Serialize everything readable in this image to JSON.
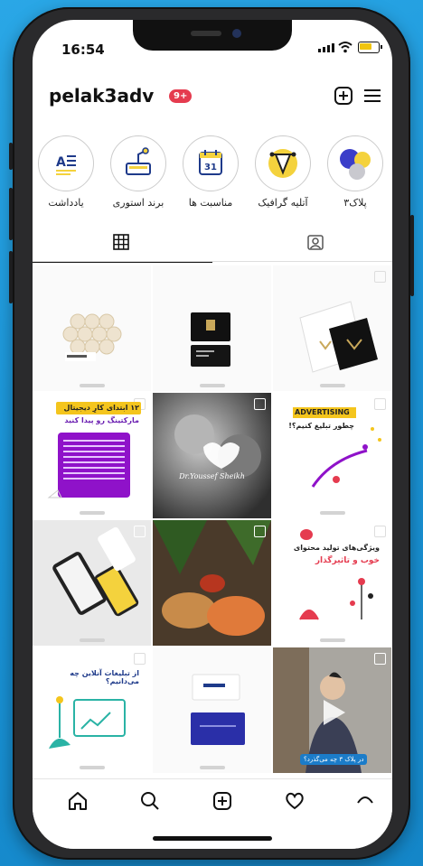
{
  "status": {
    "time": "16:54"
  },
  "header": {
    "username": "pelak3adv",
    "notification_count": "9+"
  },
  "highlights": [
    {
      "label": "پلاک۳",
      "icon": "circles-logo-icon"
    },
    {
      "label": "آتلیه گرافیک",
      "icon": "pen-tool-icon"
    },
    {
      "label": "مناسبت ها",
      "icon": "calendar-icon"
    },
    {
      "label": "برند استوری",
      "icon": "printer-robot-icon"
    },
    {
      "label": "یادداشت",
      "icon": "text-note-icon"
    }
  ],
  "posts": [
    {
      "type": "arazan-card"
    },
    {
      "type": "business-cards"
    },
    {
      "type": "brand-cards"
    },
    {
      "type": "digital-marketing",
      "line1": "۱۲ ابتدای کارِ دیجیتال",
      "line2": "مارکتینگ رو پیدا کنید"
    },
    {
      "type": "photo-portrait",
      "caption": "Dr.Youssef Sheikh"
    },
    {
      "type": "advertising",
      "line1": "ADVERTISING",
      "line2": "چطور تبلیغ کنیم؟!"
    },
    {
      "type": "app-mockup"
    },
    {
      "type": "food-photo"
    },
    {
      "type": "content-features",
      "line1": "ویژگی‌های تولید محتوای",
      "line2": "خوب و تاثیرگذار"
    },
    {
      "type": "online-ads",
      "line1": "از تبلیغات آنلاین چه می‌دانیم؟"
    },
    {
      "type": "stationery"
    },
    {
      "type": "video-speaker",
      "caption": "در پلاک ۳ چه می‌گذرد؟"
    }
  ],
  "colors": {
    "badge": "#e53b4f",
    "sky": "#1b95d8"
  }
}
